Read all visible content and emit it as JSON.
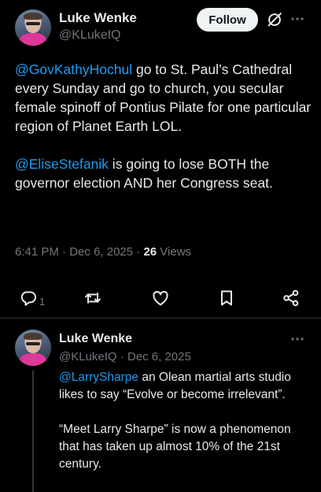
{
  "main_tweet": {
    "author_name": "Luke Wenke",
    "author_handle": "@KLukeIQ",
    "follow_label": "Follow",
    "paragraph1": {
      "mention": "@GovKathyHochul",
      "text": " go to St. Paul’s Cathedral every Sunday and go to church, you secular female spinoff of Pontius Pilate for one particular region of Planet Earth LOL."
    },
    "paragraph2": {
      "mention": "@EliseStefanik",
      "text": " is going to lose BOTH the governor election AND her Congress seat."
    },
    "time": "6:41 PM",
    "separator": " · ",
    "date": "Dec 6, 2025",
    "separator2": " · ",
    "views_count": "26",
    "views_label": " Views",
    "actions": {
      "reply_count": "1",
      "reply_icon": "reply-icon",
      "retweet_icon": "retweet-icon",
      "like_icon": "heart-icon",
      "bookmark_icon": "bookmark-icon",
      "share_icon": "share-icon"
    }
  },
  "reply_tweet": {
    "author_name": "Luke Wenke",
    "author_handle": "@KLukeIQ",
    "separator": " · ",
    "date": "Dec 6, 2025",
    "paragraph1": {
      "mention": "@LarrySharpe",
      "text": " an Olean martial arts studio likes to say “Evolve or become irrelevant”."
    },
    "paragraph2": "“Meet Larry Sharpe” is now a phenomenon that has taken up almost 10% of the 21st century."
  },
  "colors": {
    "background": "#000000",
    "text": "#e7e9ea",
    "muted": "#71767b",
    "accent": "#1d9bf0",
    "divider": "#2f3336"
  }
}
